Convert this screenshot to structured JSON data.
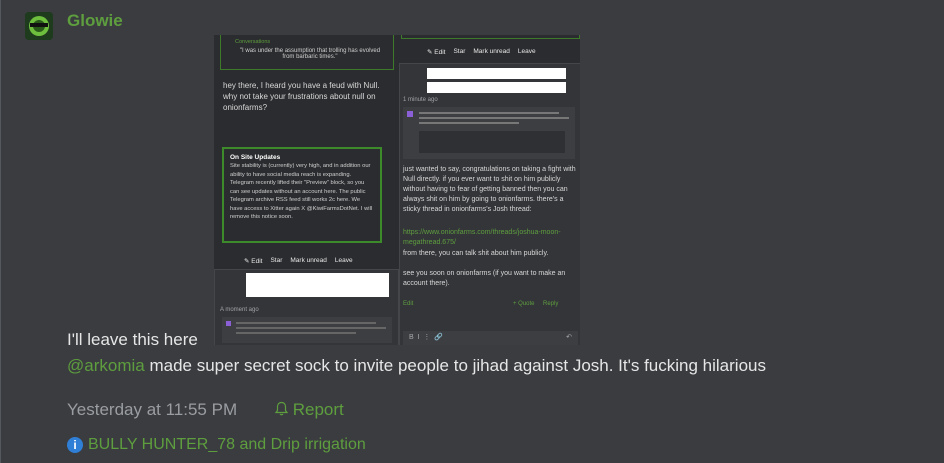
{
  "post": {
    "username": "Glowie",
    "body_line1": "I'll leave this here",
    "mention": "@arkomia",
    "body_line2": " made super secret sock to invite people to jihad against Josh. It's fucking hilarious",
    "timestamp": "Yesterday at 11:55 PM",
    "report_label": "Report",
    "reactions": "BULLY HUNTER_78 and Drip irrigation"
  },
  "embedded": {
    "left": {
      "section_label": "Conversations",
      "quote": "\"I was under the assumption that trolling has evolved from barbaric times.\"",
      "message": "hey there, I heard you have a feud with Null. why not take your frustrations about null on onionfarms?",
      "notice_title": "On Site Updates",
      "notice_text": "Site stability is (currently) very high, and in addition our ability to have social media reach is expanding. Telegram recently lifted their \"Preview\" block, so you can see updates without an account here. The public Telegram archive RSS feed still works 2c here. We have access to Xitter again X @KiwiFarmsDotNet. I will remove this notice soon.",
      "buttons": [
        "Edit",
        "Star",
        "Mark unread",
        "Leave"
      ],
      "time": "A moment ago"
    },
    "right": {
      "buttons": [
        "Edit",
        "Star",
        "Mark unread",
        "Leave"
      ],
      "time": "1 minute ago",
      "message": "just wanted to say, congratulations on taking a fight with Null directly. if you ever want to shit on him publicly without having to fear of getting banned then you can always shit on him by going to onionfarms. there's a sticky thread in onionfarms's Josh thread:",
      "link": "https://www.onionfarms.com/threads/joshua-moon-megathread.675/",
      "message2": "from there, you can talk shit about him publicly.",
      "message3": "see you soon on onionfarms (if you want to make an account there).",
      "edit": "Edit",
      "quote": "+ Quote",
      "reply": "Reply"
    }
  },
  "colors": {
    "background": "#3a3c40",
    "accent_green": "#5e9e3e",
    "info_blue": "#2f7fd6"
  }
}
